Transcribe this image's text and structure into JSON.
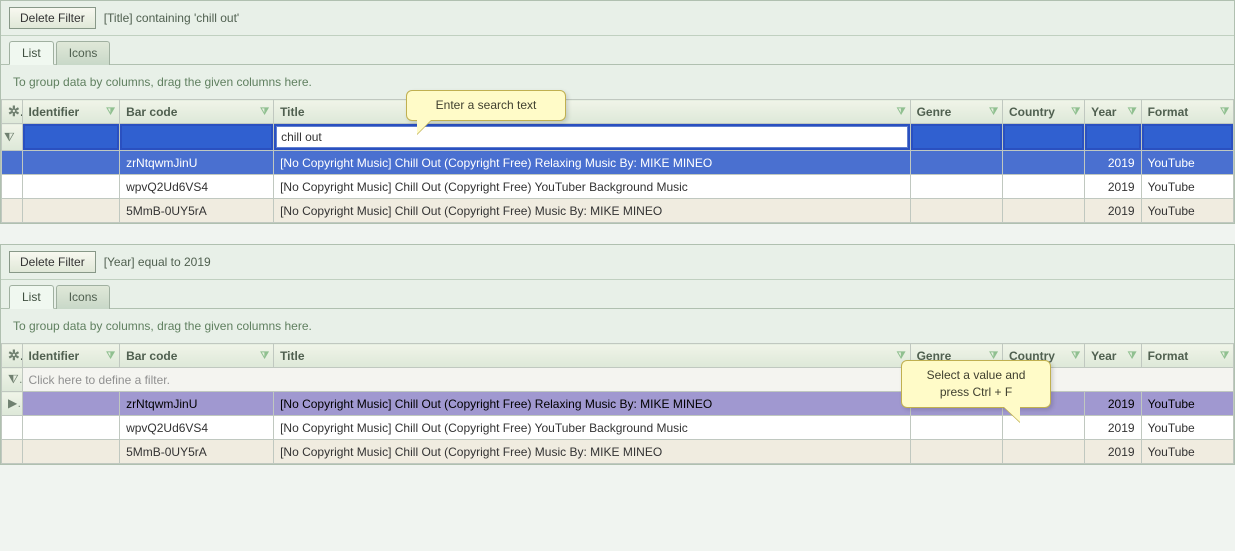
{
  "panel1": {
    "delete_filter_label": "Delete Filter",
    "filter_desc": "[Title] containing 'chill out'",
    "tabs": {
      "list": "List",
      "icons": "Icons"
    },
    "group_hint": "To group data by columns, drag the given columns here.",
    "columns": {
      "identifier": "Identifier",
      "barcode": "Bar code",
      "title": "Title",
      "genre": "Genre",
      "country": "Country",
      "year": "Year",
      "format": "Format"
    },
    "filter_value_title": "chill out",
    "callout": "Enter a search text",
    "rows": [
      {
        "barcode": "zrNtqwmJinU",
        "title": "[No Copyright Music] Chill Out (Copyright Free) Relaxing Music By: MIKE MINEO",
        "year": "2019",
        "format": "YouTube",
        "selected": true
      },
      {
        "barcode": "wpvQ2Ud6VS4",
        "title": "[No Copyright Music] Chill Out (Copyright Free) YouTuber Background Music",
        "year": "2019",
        "format": "YouTube",
        "selected": false
      },
      {
        "barcode": "5MmB-0UY5rA",
        "title": "[No Copyright Music] Chill Out (Copyright Free) Music By: MIKE MINEO",
        "year": "2019",
        "format": "YouTube",
        "selected": false
      }
    ]
  },
  "panel2": {
    "delete_filter_label": "Delete Filter",
    "filter_desc": "[Year] equal to 2019",
    "tabs": {
      "list": "List",
      "icons": "Icons"
    },
    "group_hint": "To group data by columns, drag the given columns here.",
    "columns": {
      "identifier": "Identifier",
      "barcode": "Bar code",
      "title": "Title",
      "genre": "Genre",
      "country": "Country",
      "year": "Year",
      "format": "Format"
    },
    "filter_placeholder": "Click here to define a filter.",
    "callout_line1": "Select a value and",
    "callout_line2": "press Ctrl + F",
    "rows": [
      {
        "barcode": "zrNtqwmJinU",
        "title": "[No Copyright Music] Chill Out (Copyright Free) Relaxing Music By: MIKE MINEO",
        "year": "2019",
        "format": "YouTube",
        "selected": true
      },
      {
        "barcode": "wpvQ2Ud6VS4",
        "title": "[No Copyright Music] Chill Out (Copyright Free) YouTuber Background Music",
        "year": "2019",
        "format": "YouTube",
        "selected": false
      },
      {
        "barcode": "5MmB-0UY5rA",
        "title": "[No Copyright Music] Chill Out (Copyright Free) Music By: MIKE MINEO",
        "year": "2019",
        "format": "YouTube",
        "selected": false
      }
    ]
  }
}
